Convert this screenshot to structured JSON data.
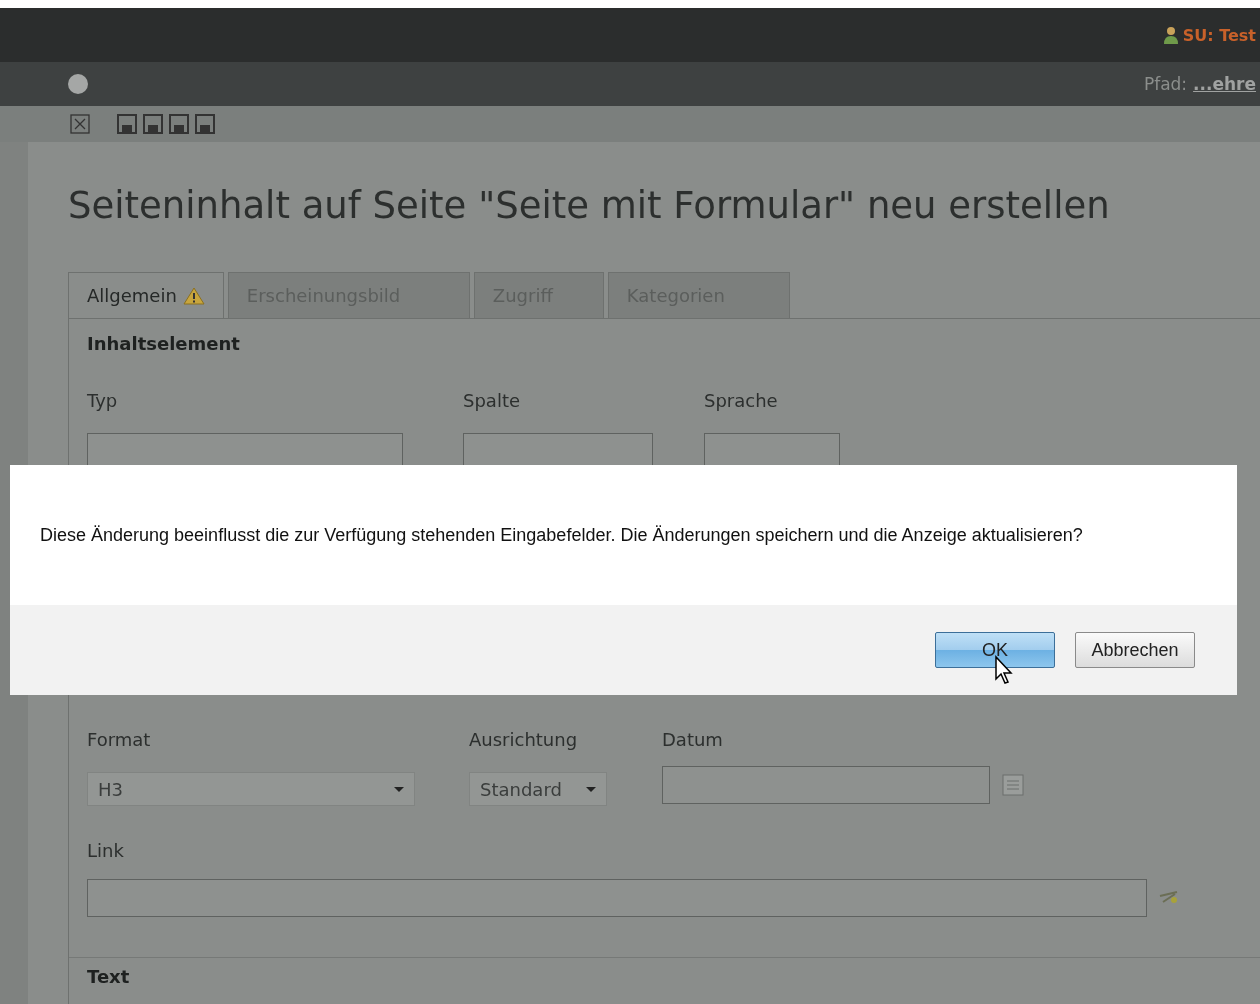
{
  "header": {
    "user": "SU: Test",
    "path_label": "Pfad:",
    "path_link": "...ehre"
  },
  "title": "Seiteninhalt auf Seite \"Seite mit Formular\" neu erstellen",
  "tabs": [
    {
      "label": "Allgemein",
      "selected": true,
      "warning": true
    },
    {
      "label": "Erscheinungsbild",
      "selected": false,
      "warning": false
    },
    {
      "label": "Zugriff",
      "selected": false,
      "warning": false
    },
    {
      "label": "Kategorien",
      "selected": false,
      "warning": false
    }
  ],
  "section": "Inhaltselement",
  "top_fields": [
    {
      "label": "Typ"
    },
    {
      "label": "Spalte"
    },
    {
      "label": "Sprache"
    }
  ],
  "fields": [
    {
      "label": "Format",
      "kind": "select",
      "value": "H3"
    },
    {
      "label": "Ausrichtung",
      "kind": "select",
      "value": "Standard"
    },
    {
      "label": "Datum",
      "kind": "date"
    }
  ],
  "link": {
    "label": "Link"
  },
  "next_section": "Text",
  "dialog": {
    "message": "Diese Änderung beeinflusst die zur Verfügung stehenden Eingabefelder. Die Änderungen speichern und die Anzeige aktualisieren?",
    "buttons": [
      {
        "label": "OK",
        "kind": "primary"
      },
      {
        "label": "Abbrechen",
        "kind": "secondary"
      }
    ]
  }
}
